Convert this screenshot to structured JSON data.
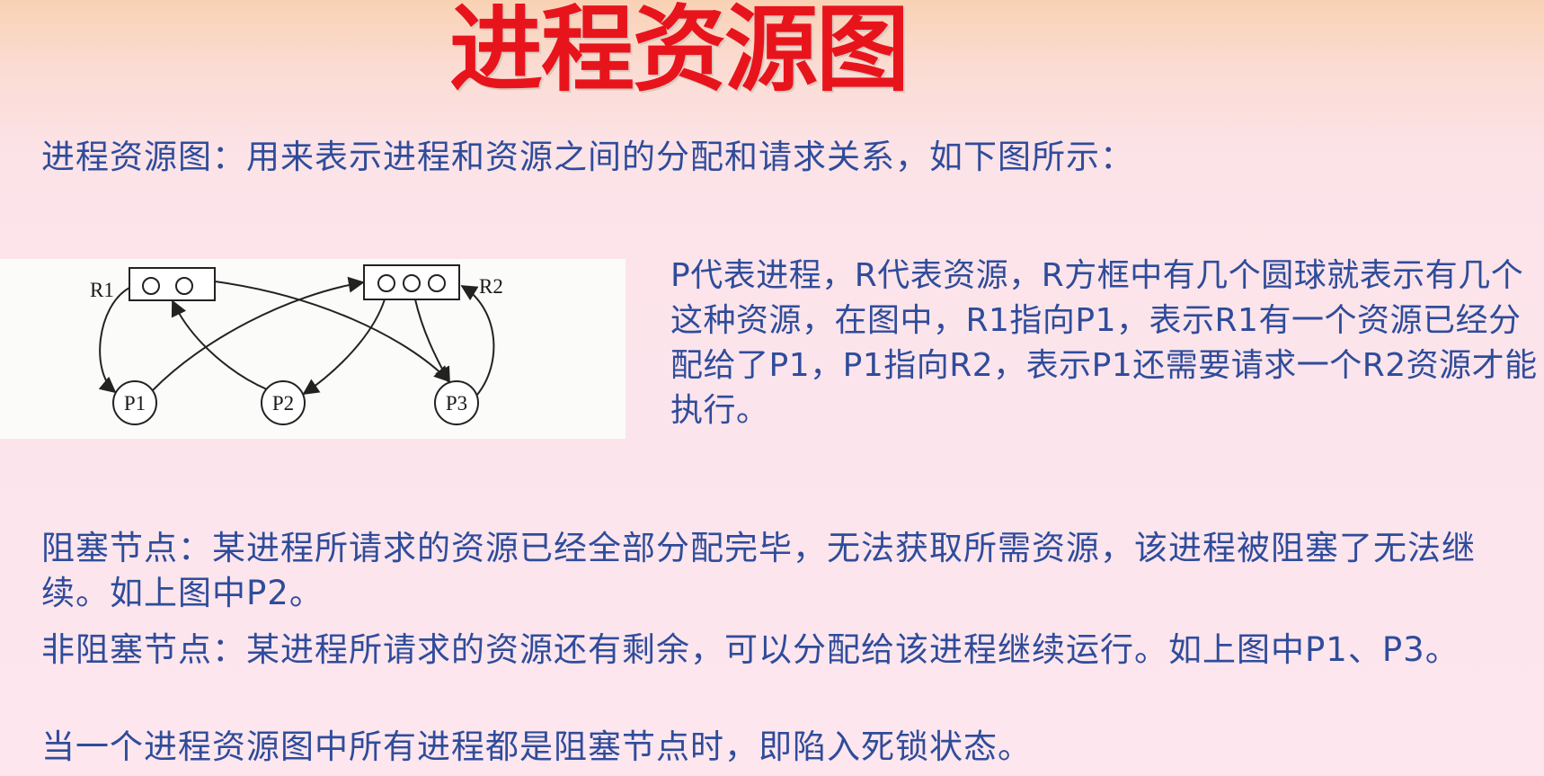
{
  "slide": {
    "title": "进程资源图"
  },
  "intro": {
    "text": "进程资源图：用来表示进程和资源之间的分配和请求关系，如下图所示："
  },
  "diagram": {
    "resources": [
      {
        "label": "R1",
        "instances": 2
      },
      {
        "label": "R2",
        "instances": 3
      }
    ],
    "processes": [
      {
        "label": "P1"
      },
      {
        "label": "P2"
      },
      {
        "label": "P3"
      }
    ],
    "edges": [
      {
        "from": "R1",
        "to": "P1",
        "kind": "allocation"
      },
      {
        "from": "R1",
        "to": "P3",
        "kind": "allocation"
      },
      {
        "from": "P1",
        "to": "R2",
        "kind": "request"
      },
      {
        "from": "P2",
        "to": "R1",
        "kind": "request"
      },
      {
        "from": "R2",
        "to": "P2",
        "kind": "allocation"
      },
      {
        "from": "R2",
        "to": "P3",
        "kind": "allocation"
      },
      {
        "from": "P3",
        "to": "R2",
        "kind": "request"
      }
    ]
  },
  "explanation": {
    "text": "P代表进程，R代表资源，R方框中有几个圆球就表示有几个这种资源，在图中，R1指向P1，表示R1有一个资源已经分配给了P1，P1指向R2，表示P1还需要请求一个R2资源才能执行。"
  },
  "blocked_node": {
    "text": "阻塞节点：某进程所请求的资源已经全部分配完毕，无法获取所需资源，该进程被阻塞了无法继续。如上图中P2。"
  },
  "non_blocked_node": {
    "text": "非阻塞节点：某进程所请求的资源还有剩余，可以分配给该进程继续运行。如上图中P1、P3。"
  },
  "deadlock": {
    "text": "当一个进程资源图中所有进程都是阻塞节点时，即陷入死锁状态。"
  },
  "colors": {
    "title": "#e8141c",
    "body_text": "#2f4c9a",
    "diagram_background": "#fbfbf9"
  }
}
